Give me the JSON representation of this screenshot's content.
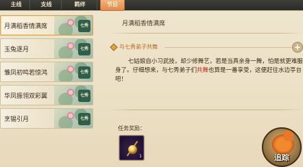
{
  "tabs": [
    {
      "label": "主线"
    },
    {
      "label": "支线"
    },
    {
      "label": "羁绊"
    },
    {
      "label": "节日"
    }
  ],
  "quests": [
    {
      "name": "月满稻香情满席",
      "seal": "七秀",
      "selected": true
    },
    {
      "name": "玉兔逐月",
      "seal": "七秀",
      "selected": false
    },
    {
      "name": "雏凤初鸣若惊鸿",
      "seal": "七秀",
      "selected": false
    },
    {
      "name": "华凤振翎双彩翼",
      "seal": "七秀",
      "selected": false
    },
    {
      "name": "烹锡引月",
      "seal": "七秀",
      "selected": false
    }
  ],
  "detail": {
    "title": "月满稻香情满席",
    "objective": "与七秀弟子共舞",
    "plus_glyph": "+",
    "desc_before": "七姑娘自小习武技，却少修舞艺，若是当真亲身一舞，怕是就更难服身了。仔细想来，与七秀弟子们",
    "desc_highlight": "共舞",
    "desc_after": "也算是一番享受，这便赶往水边亭台吧！",
    "reward_label": "任务奖励：",
    "reward_qty": "1"
  },
  "track_button": {
    "label": "追踪"
  },
  "colors": {
    "highlight": "#c8281e",
    "objective": "#b56a1d",
    "active_tab": "#e08a4a"
  },
  "icons": {
    "objective": "diamond-icon",
    "expand": "plus-icon",
    "reward": "reward-item-icon",
    "track": "horse-icon"
  }
}
